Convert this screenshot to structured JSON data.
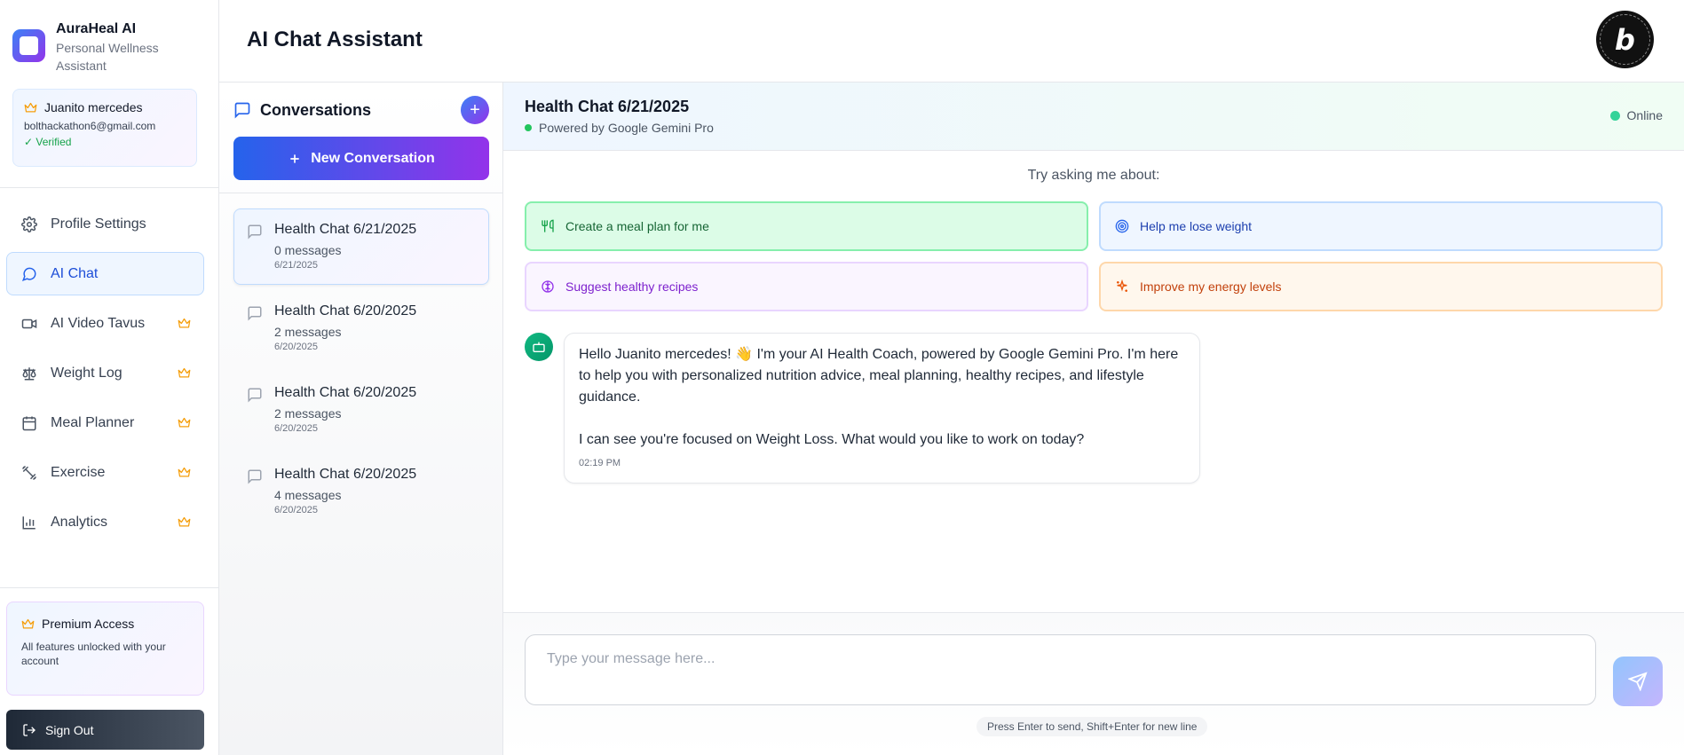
{
  "brand": {
    "name": "AuraHeal AI",
    "subtitle": "Personal Wellness Assistant"
  },
  "user": {
    "name": "Juanito mercedes",
    "email": "bolthackathon6@gmail.com",
    "status": "✓ Verified"
  },
  "nav": {
    "items": [
      {
        "label": "Profile Settings",
        "icon": "gear-icon",
        "premium": false
      },
      {
        "label": "AI Chat",
        "icon": "chat-bubble-icon",
        "premium": false,
        "active": true
      },
      {
        "label": "AI Video Tavus",
        "icon": "video-icon",
        "premium": true
      },
      {
        "label": "Weight Log",
        "icon": "scale-icon",
        "premium": true
      },
      {
        "label": "Meal Planner",
        "icon": "calendar-icon",
        "premium": true
      },
      {
        "label": "Exercise",
        "icon": "dumbbell-icon",
        "premium": true
      },
      {
        "label": "Analytics",
        "icon": "bar-chart-icon",
        "premium": true
      }
    ]
  },
  "premium": {
    "title": "Premium Access",
    "description": "All features unlocked with your account"
  },
  "signout": {
    "label": "Sign Out"
  },
  "header": {
    "title": "AI Chat Assistant"
  },
  "conversations": {
    "title": "Conversations",
    "add_label": "+",
    "new_label": "New Conversation",
    "items": [
      {
        "name": "Health Chat 6/21/2025",
        "messages": "0 messages",
        "date": "6/21/2025",
        "active": true
      },
      {
        "name": "Health Chat 6/20/2025",
        "messages": "2 messages",
        "date": "6/20/2025"
      },
      {
        "name": "Health Chat 6/20/2025",
        "messages": "2 messages",
        "date": "6/20/2025"
      },
      {
        "name": "Health Chat 6/20/2025",
        "messages": "4 messages",
        "date": "6/20/2025"
      }
    ]
  },
  "chat": {
    "title": "Health Chat 6/21/2025",
    "powered_by": "Powered by Google Gemini Pro",
    "status": "Online",
    "try_label": "Try asking me about:",
    "suggestions": [
      {
        "label": "Create a meal plan for me",
        "icon": "utensils-icon"
      },
      {
        "label": "Help me lose weight",
        "icon": "target-icon"
      },
      {
        "label": "Suggest healthy recipes",
        "icon": "brain-icon"
      },
      {
        "label": "Improve my energy levels",
        "icon": "sparkles-icon"
      }
    ],
    "messages": [
      {
        "paragraph1": "Hello Juanito mercedes! 👋 I'm your AI Health Coach, powered by Google Gemini Pro. I'm here to help you with personalized nutrition advice, meal planning, healthy recipes, and lifestyle guidance.",
        "paragraph2": "I can see you're focused on Weight Loss. What would you like to work on today?",
        "time": "02:19 PM"
      }
    ],
    "input_placeholder": "Type your message here...",
    "input_value": "",
    "hint": "Press Enter to send, Shift+Enter for new line"
  },
  "colors": {
    "accent_blue": "#2563eb",
    "accent_purple": "#9333ea",
    "premium_crown": "#f59e0b",
    "online_green": "#34d399"
  }
}
